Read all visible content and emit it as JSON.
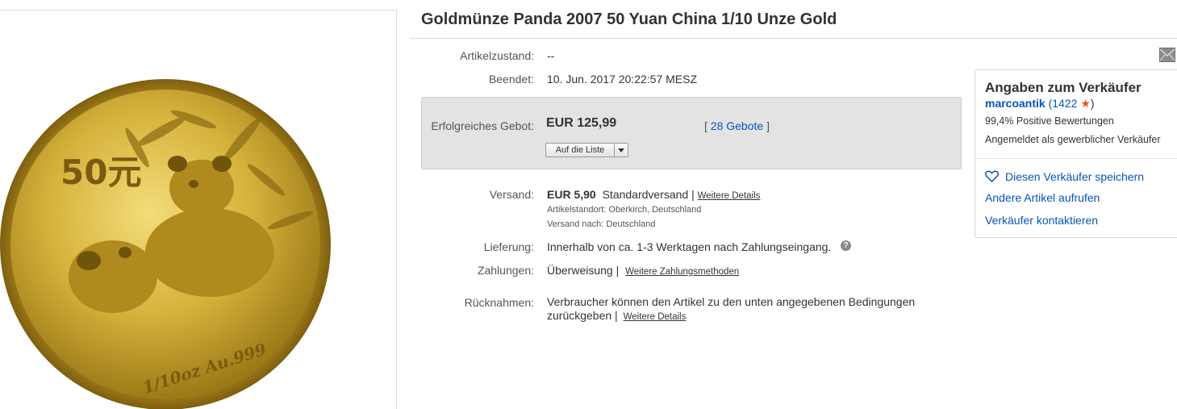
{
  "title": "Goldmünze Panda 2007 50 Yuan China 1/10 Unze Gold",
  "image": {
    "coin_denomination": "50元",
    "coin_inscription": "1/10oz Au.999"
  },
  "details": {
    "condition_label": "Artikelzustand:",
    "condition_value": "--",
    "ended_label": "Beendet:",
    "ended_value": "10. Jun. 2017  20:22:57 MESZ"
  },
  "bid": {
    "label": "Erfolgreiches Gebot:",
    "amount": "EUR 125,99",
    "bids_open": "[",
    "bids_link": "28 Gebote",
    "bids_close": "]",
    "watch_button": "Auf die Liste"
  },
  "shipping": {
    "label": "Versand:",
    "cost": "EUR 5,90",
    "method": "Standardversand |",
    "details_link": "Weitere Details",
    "location": "Artikelstandort:  Oberkirch, Deutschland",
    "ships_to": "Versand nach:  Deutschland"
  },
  "delivery": {
    "label": "Lieferung:",
    "value": "Innerhalb von ca. 1-3 Werktagen nach Zahlungseingang.",
    "help_icon": "?"
  },
  "payments": {
    "label": "Zahlungen:",
    "value": "Überweisung  |",
    "more_link": "Weitere Zahlungsmethoden"
  },
  "returns": {
    "label": "Rücknahmen:",
    "line1": "Verbraucher können den Artikel zu den unten angegebenen Bedingungen",
    "line2": "zurückgeben |",
    "details_link": "Weitere Details"
  },
  "seller": {
    "heading": "Angaben zum Verkäufer",
    "name": "marcoantik",
    "score_open": "(",
    "score": "1422",
    "score_close": ")",
    "positive": "99,4% Positive Bewertungen",
    "registered": "Angemeldet als gewerblicher Verkäufer",
    "save_link": "Diesen Verkäufer speichern",
    "other_items_link": "Andere Artikel aufrufen",
    "contact_link": "Verkäufer kontaktieren"
  },
  "icons": {
    "mail": "envelope-icon",
    "heart": "heart-icon",
    "star": "star-icon"
  },
  "colors": {
    "link": "#0654ba",
    "star": "#e8571c",
    "gold": "#c9a227"
  }
}
